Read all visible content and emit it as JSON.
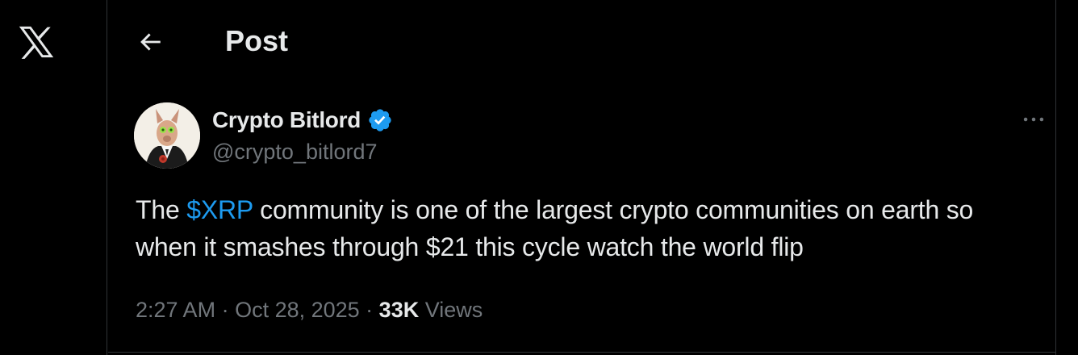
{
  "app": {
    "logo_icon": "x-logo-icon"
  },
  "header": {
    "back_icon": "arrow-left-icon",
    "title": "Post"
  },
  "post": {
    "author": {
      "display_name": "Crypto Bitlord",
      "handle": "@crypto_bitlord7",
      "verified": true,
      "verified_color": "#1d9bf0"
    },
    "more_icon": "more-horizontal-icon",
    "text_parts": {
      "before_cashtag": "The ",
      "cashtag": "$XRP",
      "after_cashtag": " community is one of the largest crypto communities on earth so when it smashes through $21 this cycle watch the world flip"
    },
    "meta": {
      "time": "2:27 AM",
      "separator": " · ",
      "date": "Oct 28, 2025",
      "views_count": "33K",
      "views_label": " Views"
    }
  },
  "colors": {
    "background": "#000000",
    "text": "#e7e9ea",
    "secondary_text": "#71767b",
    "accent": "#1d9bf0",
    "border": "#2f3336"
  }
}
